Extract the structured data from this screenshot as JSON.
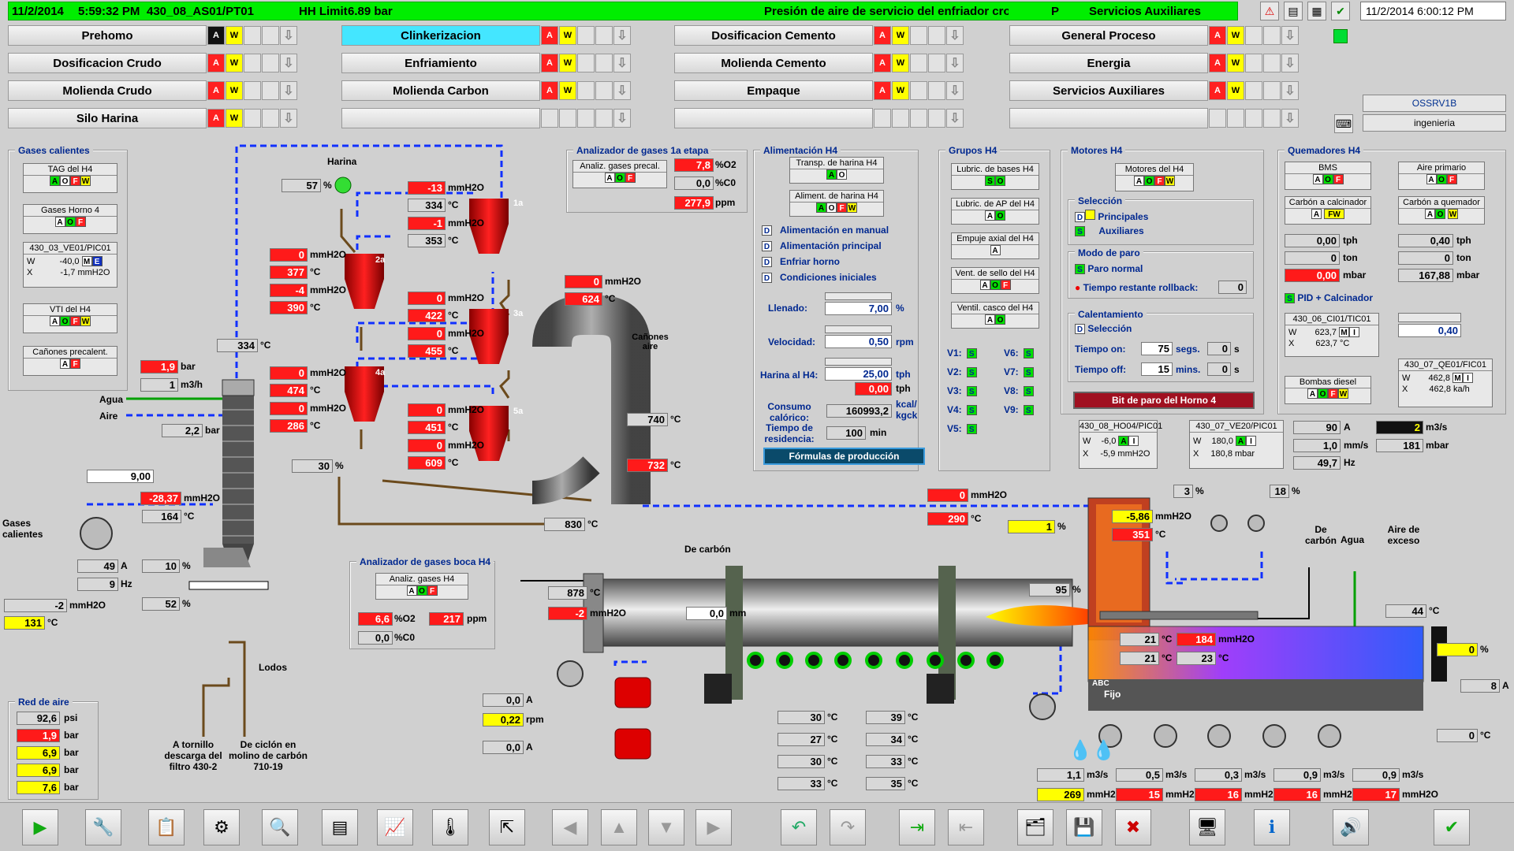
{
  "alarm": {
    "date": "11/2/2014",
    "time": "5:59:32 PM",
    "tag": "430_08_AS01/PT01",
    "limit": "HH Limit",
    "value": "6.89 bar",
    "desc": "Presión de aire de servicio del enfriador cross-B",
    "pri": "P",
    "area": "Servicios Auxiliares"
  },
  "clock": "11/2/2014 6:00:12 PM",
  "server": {
    "name": "OSSRV1B",
    "user": "ingenieria"
  },
  "nav": [
    {
      "label": "Prehomo",
      "col": 0,
      "row": 0,
      "ab": "k"
    },
    {
      "label": "Dosificacion Crudo",
      "col": 0,
      "row": 1
    },
    {
      "label": "Molienda Crudo",
      "col": 0,
      "row": 2
    },
    {
      "label": "Silo Harina",
      "col": 0,
      "row": 3
    },
    {
      "label": "Clinkerizacion",
      "col": 1,
      "row": 0,
      "active": true
    },
    {
      "label": "Enfriamiento",
      "col": 1,
      "row": 1
    },
    {
      "label": "Molienda Carbon",
      "col": 1,
      "row": 2
    },
    {
      "label": "",
      "col": 1,
      "row": 3,
      "blank": true
    },
    {
      "label": "Dosificacion Cemento",
      "col": 2,
      "row": 0
    },
    {
      "label": "Molienda Cemento",
      "col": 2,
      "row": 1
    },
    {
      "label": "Empaque",
      "col": 2,
      "row": 2
    },
    {
      "label": "",
      "col": 2,
      "row": 3,
      "blank": true
    },
    {
      "label": "General Proceso",
      "col": 3,
      "row": 0
    },
    {
      "label": "Energia",
      "col": 3,
      "row": 1
    },
    {
      "label": "Servicios Auxiliares",
      "col": 3,
      "row": 2
    },
    {
      "label": "",
      "col": 3,
      "row": 3,
      "blank": true
    }
  ],
  "gases": {
    "title": "Gases calientes",
    "tag1": "TAG del H4",
    "tag2": "Gases Horno 4",
    "pic": "430_03_VE01/PIC01",
    "w": "-40,0",
    "x": "-1,7",
    "xunit": "mmH2O",
    "vti": "VTI del H4",
    "canones": "Cañones precalent."
  },
  "precal": {
    "harina": "Harina",
    "harina_pct": "57",
    "t334": "334",
    "labels": {
      "c1": "1a",
      "c2": "2a",
      "c3": "3a",
      "c4": "4a",
      "c5": "5a"
    },
    "c1": {
      "p1": "-13",
      "t1": "334",
      "p2": "-1",
      "t2": "353"
    },
    "c2": {
      "p1": "0",
      "t1": "377",
      "p2": "-4",
      "t2": "390"
    },
    "c3": {
      "p1": "0",
      "t1": "422",
      "p2": "0",
      "t2": "455"
    },
    "c4": {
      "p1": "0",
      "t1": "474",
      "p2": "0",
      "t2": "286"
    },
    "c5": {
      "p1": "0",
      "t1": "451",
      "p2": "0",
      "t2": "609"
    },
    "split": "30",
    "ptop": "0",
    "ttop": "624",
    "t740": "740",
    "t732": "732",
    "t830": "830",
    "t878": "878",
    "pm2": "-2",
    "mmh2o": "mmH2O"
  },
  "analyzer1": {
    "title": "Analizador de gases 1a etapa",
    "box": "Analiz. gases precal.",
    "o2": "7,8",
    "co": "0,0",
    "ppm": "277,9"
  },
  "analyzer2": {
    "title": "Analizador de gases boca H4",
    "box": "Analiz. gases H4",
    "o2": "6,6",
    "co": "0,0",
    "ppm": "217"
  },
  "alim": {
    "title": "Alimentación H4",
    "b1": "Transp. de harina H4",
    "b2": "Aliment. de harina H4",
    "opts": [
      "Alimentación en manual",
      "Alimentación principal",
      "Enfriar horno",
      "Condiciones iniciales"
    ],
    "llenado": "Llenado:",
    "llen_val": "7,00",
    "llen_u": "%",
    "vel": "Velocidad:",
    "vel_val": "0,50",
    "vel_u": "rpm",
    "harina": "Harina al H4:",
    "har_val": "25,00",
    "har_u": "tph",
    "har_val2": "0,00",
    "consumo": "Consumo calórico:",
    "cons_val": "160993,2",
    "cons_u": "kcal/ kgck",
    "tiempo": "Tiempo de residencia:",
    "tiempo_val": "100",
    "tiempo_u": "min",
    "formulas": "Fórmulas de producción"
  },
  "grupos": {
    "title": "Grupos H4",
    "items": [
      "Lubric. de bases H4",
      "Lubric. de AP del H4",
      "Empuje axial del H4",
      "Vent. de sello del H4",
      "Ventil. casco del H4"
    ],
    "v": [
      "V1:",
      "V2:",
      "V3:",
      "V4:",
      "V5:",
      "V6:",
      "V7:",
      "V8:",
      "V9:"
    ]
  },
  "motores": {
    "title": "Motores H4",
    "box": "Motores del H4",
    "sel": "Selección",
    "princ": "Principales",
    "aux": "Auxiliares",
    "modo": "Modo de paro",
    "paro": "Paro normal",
    "rollback": "Tiempo restante rollback:",
    "rb_val": "0",
    "calent": "Calentamiento",
    "calsel": "Selección",
    "ton": "Tiempo on:",
    "ton_v": "75",
    "ton_u": "segs.",
    "ton_r": "0",
    "toff": "Tiempo off:",
    "toff_v": "15",
    "toff_u": "mins.",
    "toff_r": "0",
    "bit": "Bit de paro del Horno 4"
  },
  "quem": {
    "title": "Quemadores H4",
    "bms": "BMS",
    "aire": "Aire primario",
    "cc": "Carbón a calcinador",
    "cq": "Carbón a quemador",
    "tph1": "0,00",
    "tph2": "0,40",
    "ton1": "0",
    "ton2": "0",
    "mbar1": "0,00",
    "mbar2": "167,88",
    "pid": "PID + Calcinador",
    "tic": "430_06_CI01/TIC01",
    "tic_w": "623,7",
    "tic_x": "623,7",
    "fv": "0,40",
    "bombas": "Bombas diesel",
    "fic": "430_07_QE01/FIC01",
    "fic_w": "462,8",
    "fic_x": "462,8",
    "fic_u": "ka/h"
  },
  "pics": {
    "hoa": "430_08_HO04/PIC01",
    "hoa_w": "-6,0",
    "hoa_x": "-5,9",
    "vez": "430_07_VE20/PIC01",
    "vez_w": "180,0",
    "vez_x": "180,8",
    "amp": "90",
    "ms": "2",
    "mms": "1,0",
    "mbar": "181",
    "hz": "49,7"
  },
  "kiln": {
    "t164": "164",
    "p2837": "-28,37",
    "amps": "49",
    "hz": "9",
    "pct10": "10",
    "pct52": "52",
    "pm2": "-2",
    "t131": "131",
    "bar1": "1,9",
    "m3h": "1",
    "bar22": "2,2",
    "v9": "9,00",
    "agua": "Agua",
    "aire": "Aire",
    "gases": "Gases calientes",
    "a_tornillo": "A tornillo descarga del filtro 430-2",
    "ciclon": "De ciclón en molino de carbón 710-19",
    "lodos": "Lodos",
    "de_carbon": "De carbón",
    "canones": "Cañones aire",
    "mm": "0,0",
    "pct95": "95",
    "amp1": "0,0",
    "rpm": "0,22",
    "amp2": "0,0",
    "temps1": [
      "30",
      "27",
      "30",
      "33"
    ],
    "temps2": [
      "39",
      "34",
      "33",
      "35"
    ]
  },
  "cooler": {
    "p0": "0",
    "t290": "290",
    "pct1": "1",
    "p586": "-5,86",
    "t351": "351",
    "pct3": "3",
    "pct18": "18",
    "de_carbon": "De carbón",
    "agua": "Agua",
    "aire": "Aire de exceso",
    "t44": "44",
    "pct0": "0",
    "t21a": "21",
    "p184": "184",
    "t21b": "21",
    "t23": "23",
    "fijo": "Fijo",
    "abc": "ABC",
    "n8": "8",
    "t0": "0",
    "flows": [
      "1,1",
      "0,5",
      "0,3",
      "0,9",
      "0,9"
    ],
    "pres": [
      "269",
      "15",
      "16",
      "16",
      "17"
    ]
  },
  "redaire": {
    "title": "Red de aire",
    "vals": [
      "92,6",
      "1,9",
      "6,9",
      "6,9",
      "7,6"
    ],
    "units": [
      "psi",
      "bar",
      "bar",
      "bar",
      "bar"
    ]
  }
}
